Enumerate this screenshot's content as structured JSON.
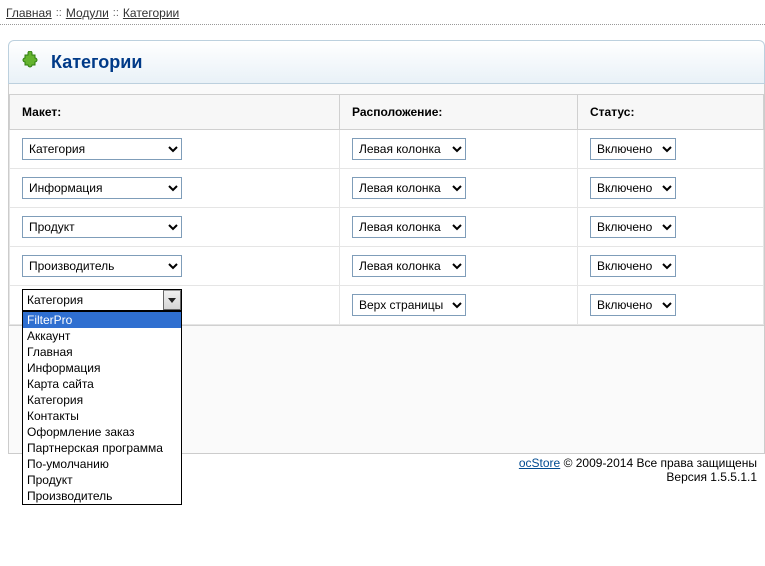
{
  "breadcrumb": {
    "home": "Главная",
    "modules": "Модули",
    "category": "Категории"
  },
  "panel": {
    "title": "Категории"
  },
  "headers": {
    "layout": "Макет:",
    "position": "Расположение:",
    "status": "Статус:"
  },
  "position_options": {
    "left": "Левая колонка",
    "top": "Верх страницы"
  },
  "status_options": {
    "enabled": "Включено"
  },
  "rows": [
    {
      "layout": "Категория",
      "position": "Левая колонка",
      "status": "Включено"
    },
    {
      "layout": "Информация",
      "position": "Левая колонка",
      "status": "Включено"
    },
    {
      "layout": "Продукт",
      "position": "Левая колонка",
      "status": "Включено"
    },
    {
      "layout": "Производитель",
      "position": "Левая колонка",
      "status": "Включено"
    },
    {
      "layout": "Категория",
      "position": "Верх страницы",
      "status": "Включено"
    }
  ],
  "dropdown": {
    "current": "Категория",
    "highlighted": "FilterPro",
    "options": [
      "FilterPro",
      "Аккаунт",
      "Главная",
      "Информация",
      "Карта сайта",
      "Категория",
      "Контакты",
      "Оформление заказ",
      "Партнерская программа",
      "По-умолчанию",
      "Продукт",
      "Производитель"
    ]
  },
  "footer": {
    "brand": "ocStore",
    "rights": " © 2009-2014 Все права защищены",
    "version": "Версия 1.5.5.1.1"
  }
}
